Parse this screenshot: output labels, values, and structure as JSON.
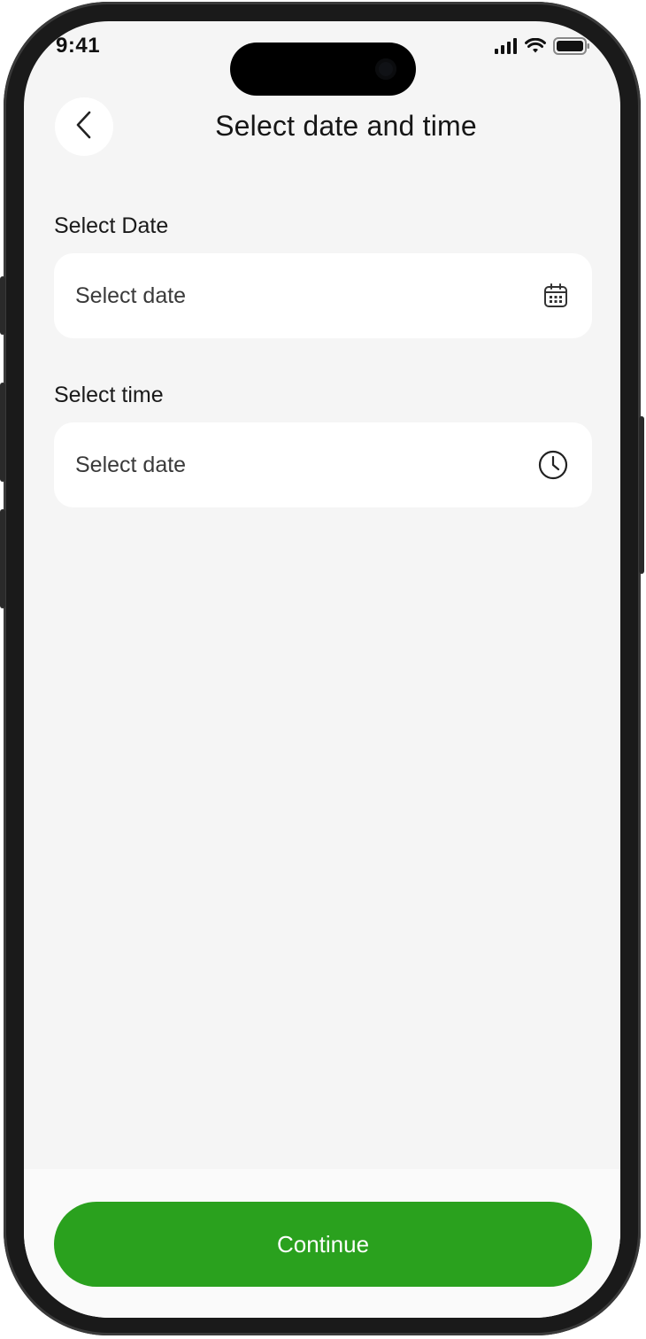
{
  "status_bar": {
    "time": "9:41",
    "icons": [
      "cellular-signal-icon",
      "wifi-icon",
      "battery-icon"
    ]
  },
  "header": {
    "back_icon": "chevron-left-icon",
    "title": "Select date and time"
  },
  "form": {
    "date": {
      "label": "Select Date",
      "placeholder": "Select date",
      "icon": "calendar-icon"
    },
    "time": {
      "label": "Select time",
      "placeholder": "Select date",
      "icon": "clock-icon"
    }
  },
  "footer": {
    "continue_label": "Continue"
  },
  "colors": {
    "accent": "#2aa11e",
    "background": "#f5f5f5",
    "surface": "#ffffff",
    "text": "#161616"
  }
}
